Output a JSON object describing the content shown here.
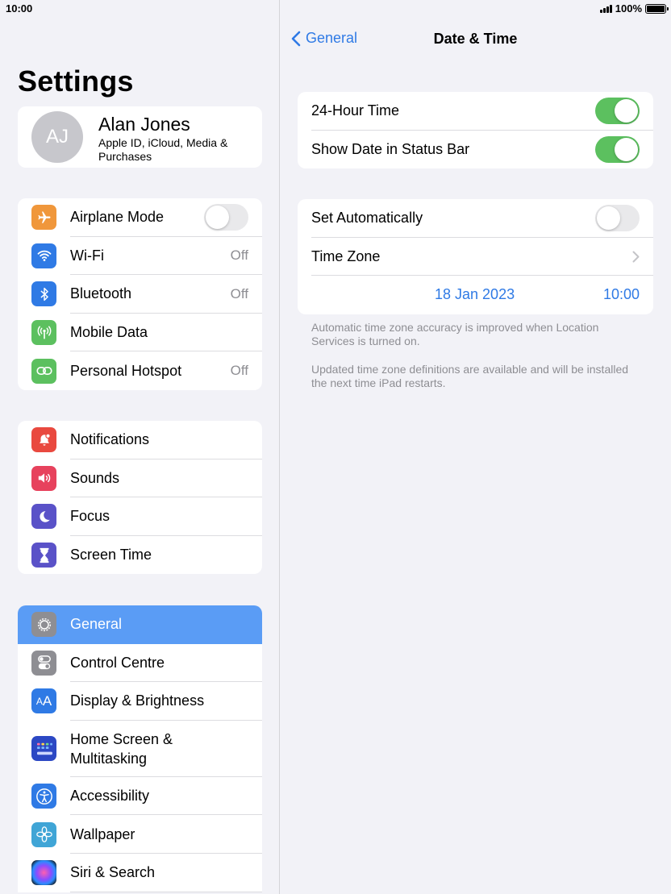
{
  "status_bar": {
    "time": "10:00",
    "battery": "100%"
  },
  "sidebar": {
    "title": "Settings",
    "profile": {
      "initials": "AJ",
      "name": "Alan Jones",
      "subtitle": "Apple ID, iCloud, Media & Purchases"
    },
    "groups": [
      [
        {
          "label": "Airplane Mode",
          "icon": "airplane-icon",
          "color": "#f0973b",
          "toggle": false
        },
        {
          "label": "Wi-Fi",
          "icon": "wifi-icon",
          "color": "#2f7ae5",
          "value": "Off"
        },
        {
          "label": "Bluetooth",
          "icon": "bluetooth-icon",
          "color": "#2f7ae5",
          "value": "Off"
        },
        {
          "label": "Mobile Data",
          "icon": "antenna-icon",
          "color": "#5cc05f"
        },
        {
          "label": "Personal Hotspot",
          "icon": "hotspot-icon",
          "color": "#5cc05f",
          "value": "Off"
        }
      ],
      [
        {
          "label": "Notifications",
          "icon": "notifications-icon",
          "color": "#e9493f"
        },
        {
          "label": "Sounds",
          "icon": "speaker-icon",
          "color": "#e7425d"
        },
        {
          "label": "Focus",
          "icon": "moon-icon",
          "color": "#5a52c8"
        },
        {
          "label": "Screen Time",
          "icon": "hourglass-icon",
          "color": "#5a52c8"
        }
      ],
      [
        {
          "label": "General",
          "icon": "gear-icon",
          "color": "#8e8e93",
          "selected": true
        },
        {
          "label": "Control Centre",
          "icon": "toggles-icon",
          "color": "#8e8e93"
        },
        {
          "label": "Display & Brightness",
          "icon": "text-size-icon",
          "color": "#2f7ae5"
        },
        {
          "label": "Home Screen & Multitasking",
          "icon": "home-grid-icon",
          "color": "#2c48c4",
          "tall": true
        },
        {
          "label": "Accessibility",
          "icon": "accessibility-icon",
          "color": "#2f7ae5"
        },
        {
          "label": "Wallpaper",
          "icon": "flower-icon",
          "color": "#40a5d6"
        },
        {
          "label": "Siri & Search",
          "icon": "siri-icon",
          "color": "#222"
        }
      ]
    ]
  },
  "detail": {
    "back_label": "General",
    "title": "Date & Time",
    "row_24h": "24-Hour Time",
    "row_statusbar": "Show Date in Status Bar",
    "row_set_auto": "Set Automatically",
    "row_timezone": "Time Zone",
    "date_value": "18 Jan 2023",
    "time_value": "10:00",
    "footnote_1": "Automatic time zone accuracy is improved when Location Services is turned on.",
    "footnote_2": "Updated time zone definitions are available and will be installed the next time iPad restarts.",
    "toggles": {
      "hour24": true,
      "show_date": true,
      "set_automatically": false
    }
  }
}
